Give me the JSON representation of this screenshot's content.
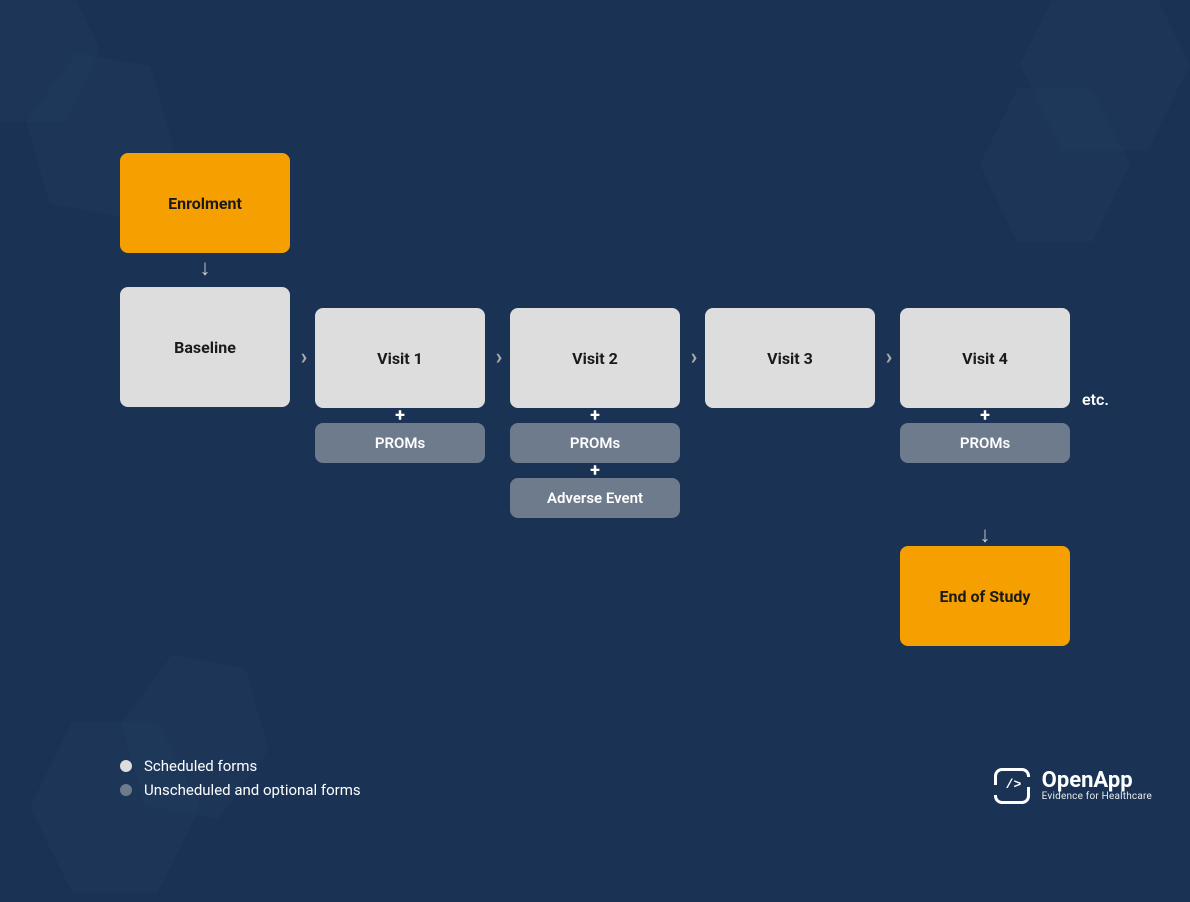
{
  "nodes": {
    "enrolment": "Enrolment",
    "baseline": "Baseline",
    "visit1": "Visit 1",
    "visit2": "Visit 2",
    "visit3": "Visit 3",
    "visit4": "Visit 4",
    "end": "End of Study"
  },
  "pills": {
    "proms": "PROMs",
    "adverse": "Adverse Event"
  },
  "etc": "etc.",
  "legend": {
    "scheduled": "Scheduled forms",
    "unscheduled": "Unscheduled and optional forms"
  },
  "brand": {
    "name": "OpenApp",
    "tagline": "Evidence for Healthcare",
    "iconGlyph": "/>"
  }
}
